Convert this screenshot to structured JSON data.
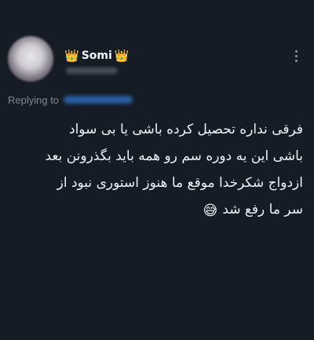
{
  "tweet": {
    "author": {
      "name": "Somi",
      "left_badge": "👑",
      "right_badge": "👑",
      "avatar_icon": "avatar-blurred"
    },
    "more_icon": "more-vertical-icon",
    "reply_label": "Replying to",
    "body_lines": [
      "فرقی نداره تحصیل کرده باشی یا بی سواد",
      "باشی این یه دوره سم رو همه باید بگذرونن بعد",
      "ازدواج شکرخدا موقع ما هنوز استوری نبود از",
      "سر ما رفع شد"
    ],
    "body_emoji": "😅"
  },
  "colors": {
    "background": "#151c26",
    "text": "#eef1f5",
    "muted": "#7d8794",
    "link": "#2f6fc0"
  }
}
